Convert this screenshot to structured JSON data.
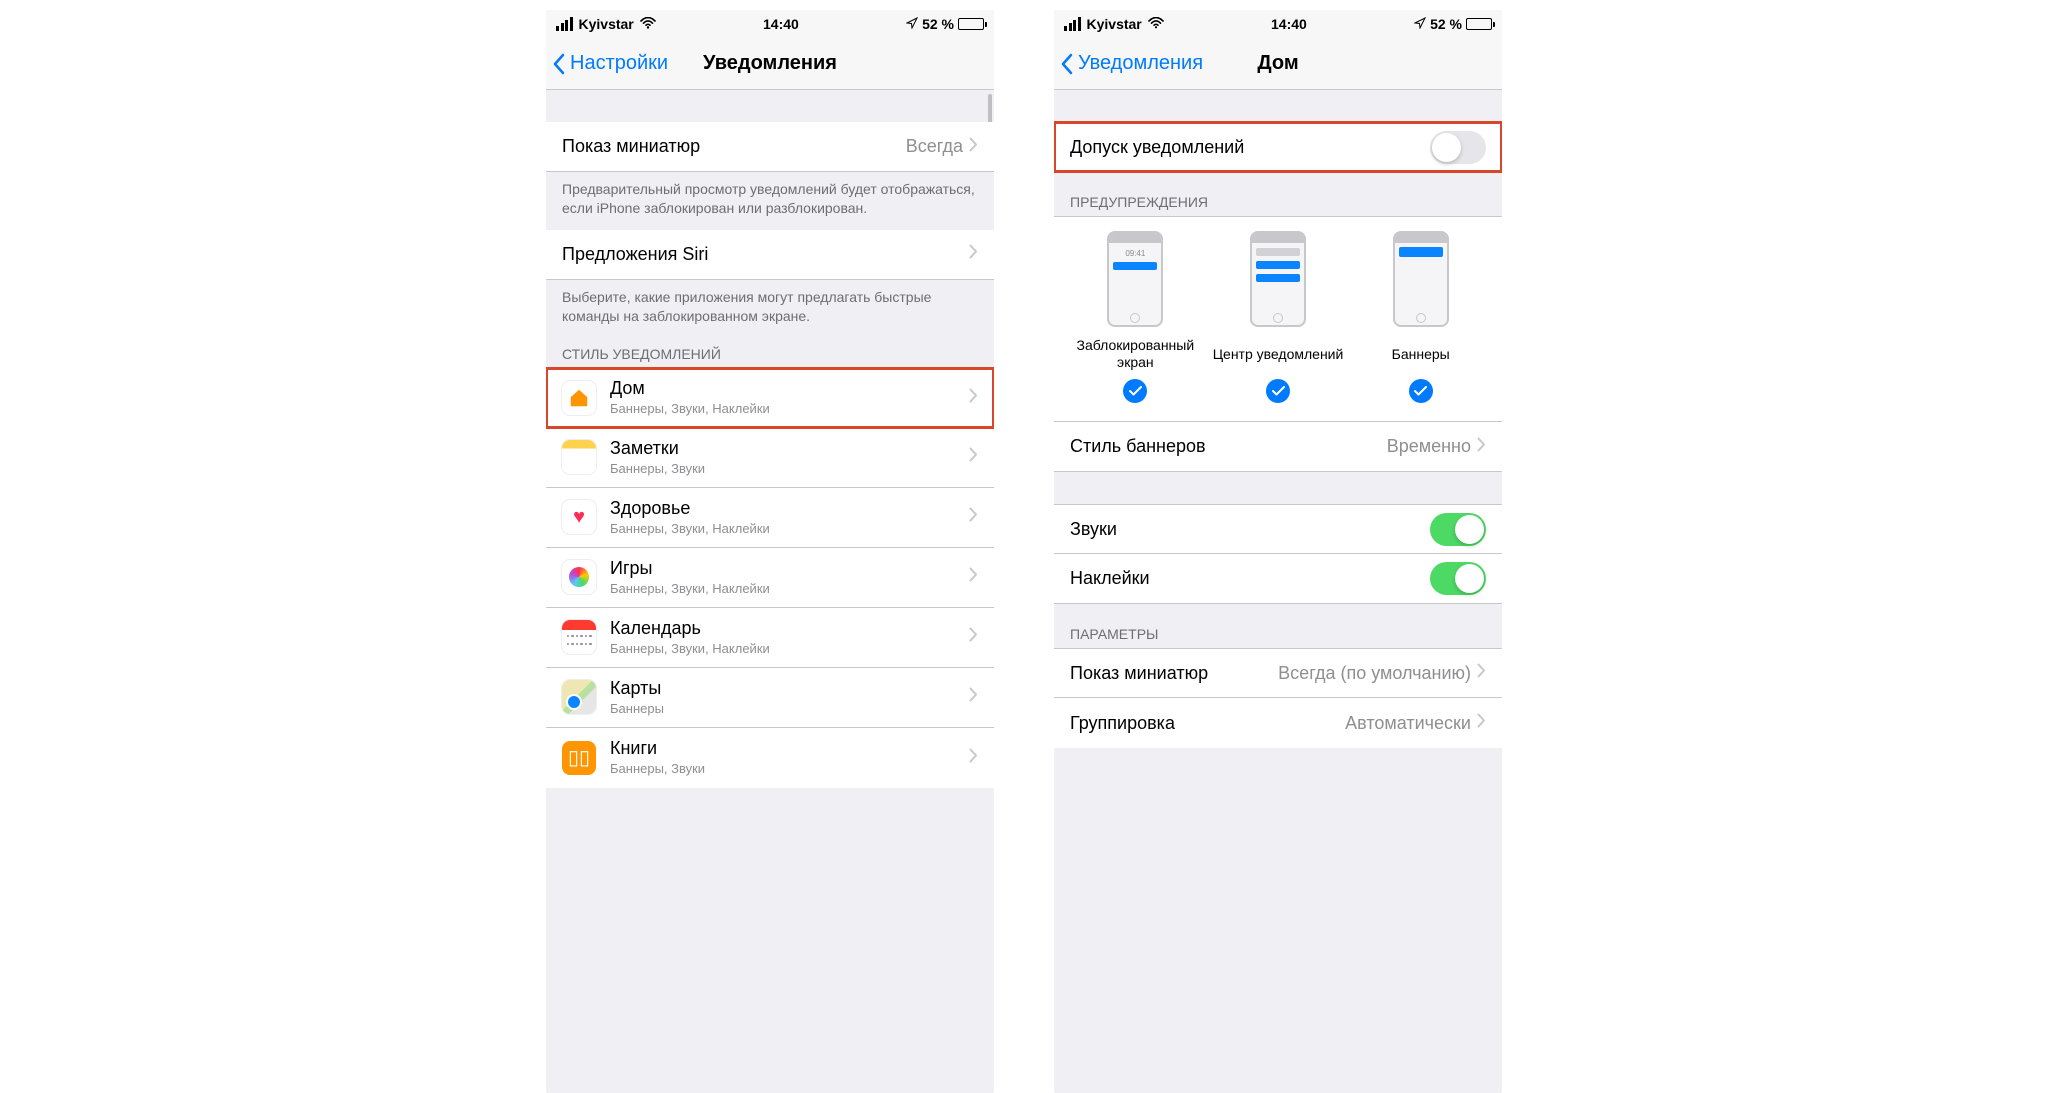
{
  "status": {
    "carrier": "Kyivstar",
    "time": "14:40",
    "battery_pct": "52 %"
  },
  "phone1": {
    "back": "Настройки",
    "title": "Уведомления",
    "row_preview": {
      "label": "Показ миниатюр",
      "value": "Всегда"
    },
    "footer_preview": "Предварительный просмотр уведомлений будет отображаться, если iPhone заблокирован или разблокирован.",
    "row_siri": {
      "label": "Предложения Siri"
    },
    "footer_siri": "Выберите, какие приложения могут предлагать быстрые команды на заблокированном экране.",
    "section_style": "СТИЛЬ УВЕДОМЛЕНИЙ",
    "apps": [
      {
        "title": "Дом",
        "sub": "Баннеры, Звуки, Наклейки",
        "icon": "home"
      },
      {
        "title": "Заметки",
        "sub": "Баннеры, Звуки",
        "icon": "notes"
      },
      {
        "title": "Здоровье",
        "sub": "Баннеры, Звуки, Наклейки",
        "icon": "health"
      },
      {
        "title": "Игры",
        "sub": "Баннеры, Звуки, Наклейки",
        "icon": "games"
      },
      {
        "title": "Календарь",
        "sub": "Баннеры, Звуки, Наклейки",
        "icon": "cal"
      },
      {
        "title": "Карты",
        "sub": "Баннеры",
        "icon": "maps"
      },
      {
        "title": "Книги",
        "sub": "Баннеры, Звуки",
        "icon": "books"
      }
    ]
  },
  "phone2": {
    "back": "Уведомления",
    "title": "Дом",
    "row_allow": "Допуск уведомлений",
    "section_alerts": "ПРЕДУПРЕЖДЕНИЯ",
    "alert_opts": [
      "Заблокированный экран",
      "Центр уведомлений",
      "Баннеры"
    ],
    "preview_time": "09:41",
    "row_banner_style": {
      "label": "Стиль баннеров",
      "value": "Временно"
    },
    "row_sounds": "Звуки",
    "row_badges": "Наклейки",
    "section_params": "ПАРАМЕТРЫ",
    "row_show_prev": {
      "label": "Показ миниатюр",
      "value": "Всегда (по умолчанию)"
    },
    "row_group": {
      "label": "Группировка",
      "value": "Автоматически"
    }
  }
}
